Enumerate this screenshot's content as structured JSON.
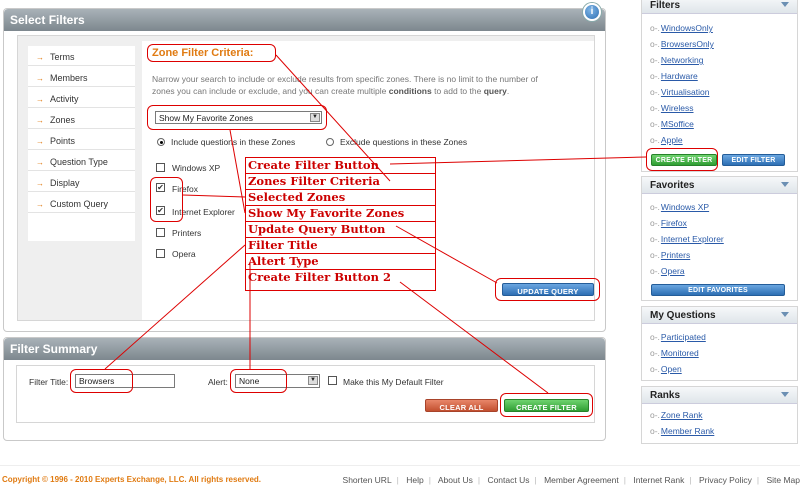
{
  "select_filters": {
    "title": "Select Filters",
    "info_icon": "i",
    "nav": [
      "Terms",
      "Members",
      "Activity",
      "Zones",
      "Points",
      "Question Type",
      "Display",
      "Custom Query"
    ],
    "zone_title": "Zone Filter Criteria:",
    "desc_1": "Narrow your search to include or exclude results from specific zones. There is no limit to the number of",
    "desc_2a": "zones you can include or exclude, and you can create multiple ",
    "desc_2b": "conditions",
    "desc_2c": " to add to the ",
    "desc_2d": "query",
    "desc_2e": ".",
    "zone_select": "Show My Favorite Zones",
    "radio_include": "Include questions in these Zones",
    "radio_exclude": "Exclude questions in these Zones",
    "zones": [
      {
        "label": "Windows XP",
        "checked": false
      },
      {
        "label": "Firefox",
        "checked": true
      },
      {
        "label": "Internet Explorer",
        "checked": true
      },
      {
        "label": "Printers",
        "checked": false
      },
      {
        "label": "Opera",
        "checked": false
      }
    ],
    "update_query": "UPDATE QUERY"
  },
  "filter_summary": {
    "title": "Filter Summary",
    "filter_title_label": "Filter Title:",
    "filter_title_value": "Browsers",
    "alert_label": "Alert:",
    "alert_value": "None",
    "default_label": "Make this My Default Filter",
    "clear_all": "CLEAR ALL",
    "create_filter": "CREATE FILTER"
  },
  "sidebar": {
    "filters": {
      "title": "Filters",
      "items": [
        "WindowsOnly",
        "BrowsersOnly",
        "Networking",
        "Hardware",
        "Virtualisation",
        "Wireless",
        "MSoffice",
        "Apple"
      ],
      "create": "CREATE FILTER",
      "edit": "EDIT FILTER"
    },
    "favorites": {
      "title": "Favorites",
      "items": [
        "Windows XP",
        "Firefox",
        "Internet Explorer",
        "Printers",
        "Opera"
      ],
      "edit": "EDIT FAVORITES"
    },
    "questions": {
      "title": "My Questions",
      "items": [
        "Participated",
        "Monitored",
        "Open"
      ]
    },
    "ranks": {
      "title": "Ranks",
      "items": [
        "Zone Rank",
        "Member Rank"
      ]
    }
  },
  "annotations": [
    "Create Filter Button",
    "Zones Filter Criteria",
    "Selected Zones",
    "Show My Favorite Zones",
    "Update Query Button",
    "Filter Title",
    "Altert Type",
    "Create Filter Button 2"
  ],
  "footer": {
    "copyright": "Copyright © 1996 - 2010 Experts Exchange, LLC. All rights reserved.",
    "links": [
      "Shorten URL",
      "Help",
      "About Us",
      "Contact Us",
      "Member Agreement",
      "Internet Rank",
      "Privacy Policy",
      "Site Map"
    ]
  },
  "colors": {
    "accent_orange": "#e07b12",
    "annotation_red": "#dd0000",
    "link_blue": "#2a5aa8",
    "button_blue": "#2d6fb4",
    "button_green": "#2f9e33",
    "button_red": "#c2502f"
  },
  "icons": {
    "info": "info-icon",
    "nav_arrow": "arrow-right-icon",
    "dropdown": "chevron-down-icon",
    "section_collapse": "triangle-down-icon"
  }
}
